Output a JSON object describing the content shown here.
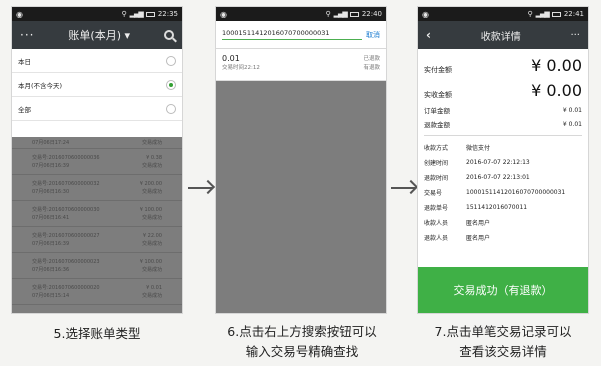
{
  "phone1": {
    "time": "22:35",
    "title": "账单(本月)",
    "menu": [
      {
        "label": "本日",
        "selected": false
      },
      {
        "label": "本月(不含今天)",
        "selected": true
      },
      {
        "label": "全部",
        "selected": false
      }
    ],
    "top_row": {
      "date": "07月06日17:24",
      "status": "交易成功"
    },
    "rows": [
      {
        "id": "交易号:2016070600000036",
        "amount": "¥ 0.38",
        "date": "07月06日16:39",
        "status": "交易成功"
      },
      {
        "id": "交易号:2016070600000032",
        "amount": "¥ 200.00",
        "date": "07月06日16:30",
        "status": "交易成功"
      },
      {
        "id": "交易号:2016070600000030",
        "amount": "¥ 100.00",
        "date": "07月06日16:41",
        "status": "交易成功"
      },
      {
        "id": "交易号:2016070600000027",
        "amount": "¥ 22.00",
        "date": "07月06日16:39",
        "status": "交易成功"
      },
      {
        "id": "交易号:2016070600000023",
        "amount": "¥ 100.00",
        "date": "07月06日16:36",
        "status": "交易成功"
      },
      {
        "id": "交易号:2016070600000020",
        "amount": "¥ 0.01",
        "date": "07月06日15:14",
        "status": "交易成功"
      }
    ]
  },
  "phone2": {
    "time": "22:40",
    "query": "10001511412016070700000031",
    "cancel": "取消",
    "result": {
      "amount": "0.01",
      "badge": "已退款",
      "time": "交易时间22:12",
      "status": "有退款"
    }
  },
  "phone3": {
    "time": "22:41",
    "title": "收款详情",
    "paid_label": "实付金额",
    "paid_value": "¥ 0.00",
    "received_label": "实收金额",
    "received_value": "¥ 0.00",
    "order_label": "订单金额",
    "order_value": "¥ 0.01",
    "refund_label": "退款金额",
    "refund_value": "¥ 0.01",
    "details": [
      {
        "k": "收款方式",
        "v": "微信支付"
      },
      {
        "k": "创建时间",
        "v": "2016-07-07 22:12:13"
      },
      {
        "k": "退款时间",
        "v": "2016-07-07 22:13:01"
      },
      {
        "k": "交易号",
        "v": "10001511412016070700000031"
      },
      {
        "k": "退款单号",
        "v": "1511412016070011"
      },
      {
        "k": "收款人员",
        "v": "匿名用户"
      },
      {
        "k": "退款人员",
        "v": "匿名用户"
      }
    ],
    "button": "交易成功（有退款）"
  },
  "captions": {
    "c1": "5.选择账单类型",
    "c2_line1": "6.点击右上方搜索按钮可以",
    "c2_line2": "输入交易号精确查找",
    "c3_line1": "7.点击单笔交易记录可以",
    "c3_line2": "查看该交易详情"
  }
}
